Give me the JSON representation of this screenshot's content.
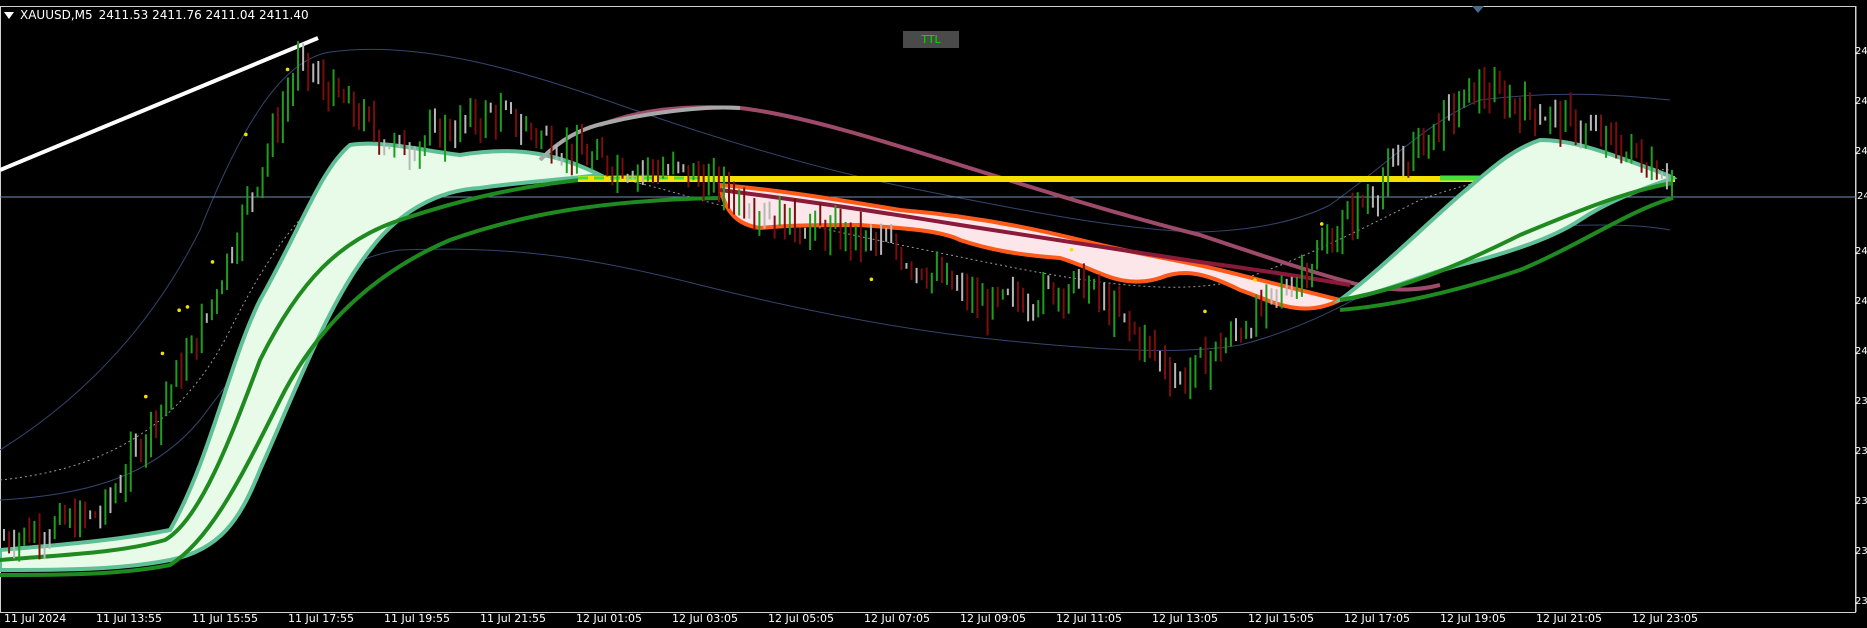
{
  "header": {
    "symbol": "XAUUSD,M5",
    "ohlc": "2411.53 2411.76 2411.04 2411.40"
  },
  "badge": {
    "label": "TTL"
  },
  "price_axis": {
    "labels": [
      "24",
      "24",
      "24",
      "24",
      "24",
      "24",
      "23",
      "23",
      "23",
      "23",
      "23",
      "23",
      "23"
    ],
    "current_price_label": "24"
  },
  "time_axis": {
    "labels": [
      "11 Jul 2024",
      "11 Jul 13:55",
      "11 Jul 15:55",
      "11 Jul 17:55",
      "11 Jul 19:55",
      "11 Jul 21:55",
      "12 Jul 01:05",
      "12 Jul 03:05",
      "12 Jul 05:05",
      "12 Jul 07:05",
      "12 Jul 09:05",
      "12 Jul 11:05",
      "12 Jul 13:05",
      "12 Jul 15:05",
      "12 Jul 17:05",
      "12 Jul 19:05",
      "12 Jul 21:05",
      "12 Jul 23:05"
    ]
  },
  "colors": {
    "background": "#000000",
    "bull_bar": "#1e9e1e",
    "bear_bar": "#7a0d0d",
    "neutral_bar": "#b8b8b8",
    "level_line": "#f5e000",
    "bull_band_fill": "#e8fbe8",
    "bull_band_edge": "#5fbf96",
    "bear_band_fill": "#fde6e9",
    "bear_band_edge": "#ff5a1a",
    "slow_ma": "#9e4a6a",
    "trend_line": "#ffffff",
    "envelope": "#34466e",
    "signal_dot": "#f0e000"
  },
  "chart_data": {
    "type": "line",
    "title": "XAUUSD,M5",
    "x": [
      "11 Jul 2024",
      "11 Jul 13:55",
      "11 Jul 15:55",
      "11 Jul 17:55",
      "11 Jul 19:55",
      "11 Jul 21:55",
      "12 Jul 01:05",
      "12 Jul 03:05",
      "12 Jul 05:05",
      "12 Jul 07:05",
      "12 Jul 09:05",
      "12 Jul 11:05",
      "12 Jul 13:05",
      "12 Jul 15:05",
      "12 Jul 17:05",
      "12 Jul 19:05",
      "12 Jul 21:05",
      "12 Jul 23:05"
    ],
    "series": [
      {
        "values": [
          2381,
          2383,
          2398,
          2420,
          2413,
          2416,
          2412,
          2411,
          2407,
          2405,
          2400,
          2402,
          2394,
          2401,
          2410,
          2418,
          2415,
          2411
        ]
      }
    ],
    "last_ohlc": {
      "open": 2411.53,
      "high": 2411.76,
      "low": 2411.04,
      "close": 2411.4
    },
    "grid": false,
    "legend": "none"
  }
}
